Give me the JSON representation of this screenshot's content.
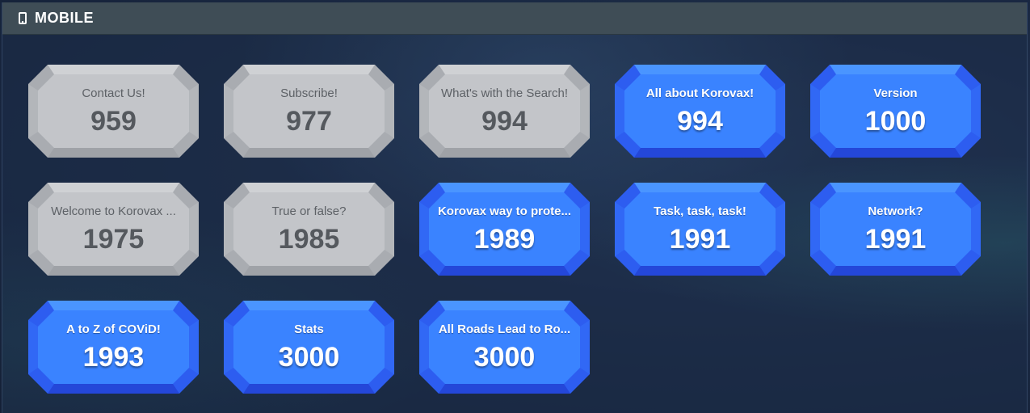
{
  "header": {
    "title": "MOBILE",
    "icon": "mobile-phone-icon"
  },
  "colors": {
    "locked_face": "#c3c5c9",
    "unlocked_face": "#3a83ff",
    "header_bg": "#3f4d56"
  },
  "badges": [
    {
      "label": "Contact Us!",
      "value": "959",
      "state": "locked"
    },
    {
      "label": "Subscribe!",
      "value": "977",
      "state": "locked"
    },
    {
      "label": "What's with the Search!",
      "value": "994",
      "state": "locked"
    },
    {
      "label": "All about Korovax!",
      "value": "994",
      "state": "unlocked"
    },
    {
      "label": "Version",
      "value": "1000",
      "state": "unlocked"
    },
    {
      "label": "Welcome to Korovax ...",
      "value": "1975",
      "state": "locked"
    },
    {
      "label": "True or false?",
      "value": "1985",
      "state": "locked"
    },
    {
      "label": "Korovax way to prote...",
      "value": "1989",
      "state": "unlocked"
    },
    {
      "label": "Task, task, task!",
      "value": "1991",
      "state": "unlocked"
    },
    {
      "label": "Network?",
      "value": "1991",
      "state": "unlocked"
    },
    {
      "label": "A to Z of COViD!",
      "value": "1993",
      "state": "unlocked"
    },
    {
      "label": "Stats",
      "value": "3000",
      "state": "unlocked"
    },
    {
      "label": "All Roads Lead to Ro...",
      "value": "3000",
      "state": "unlocked"
    }
  ]
}
